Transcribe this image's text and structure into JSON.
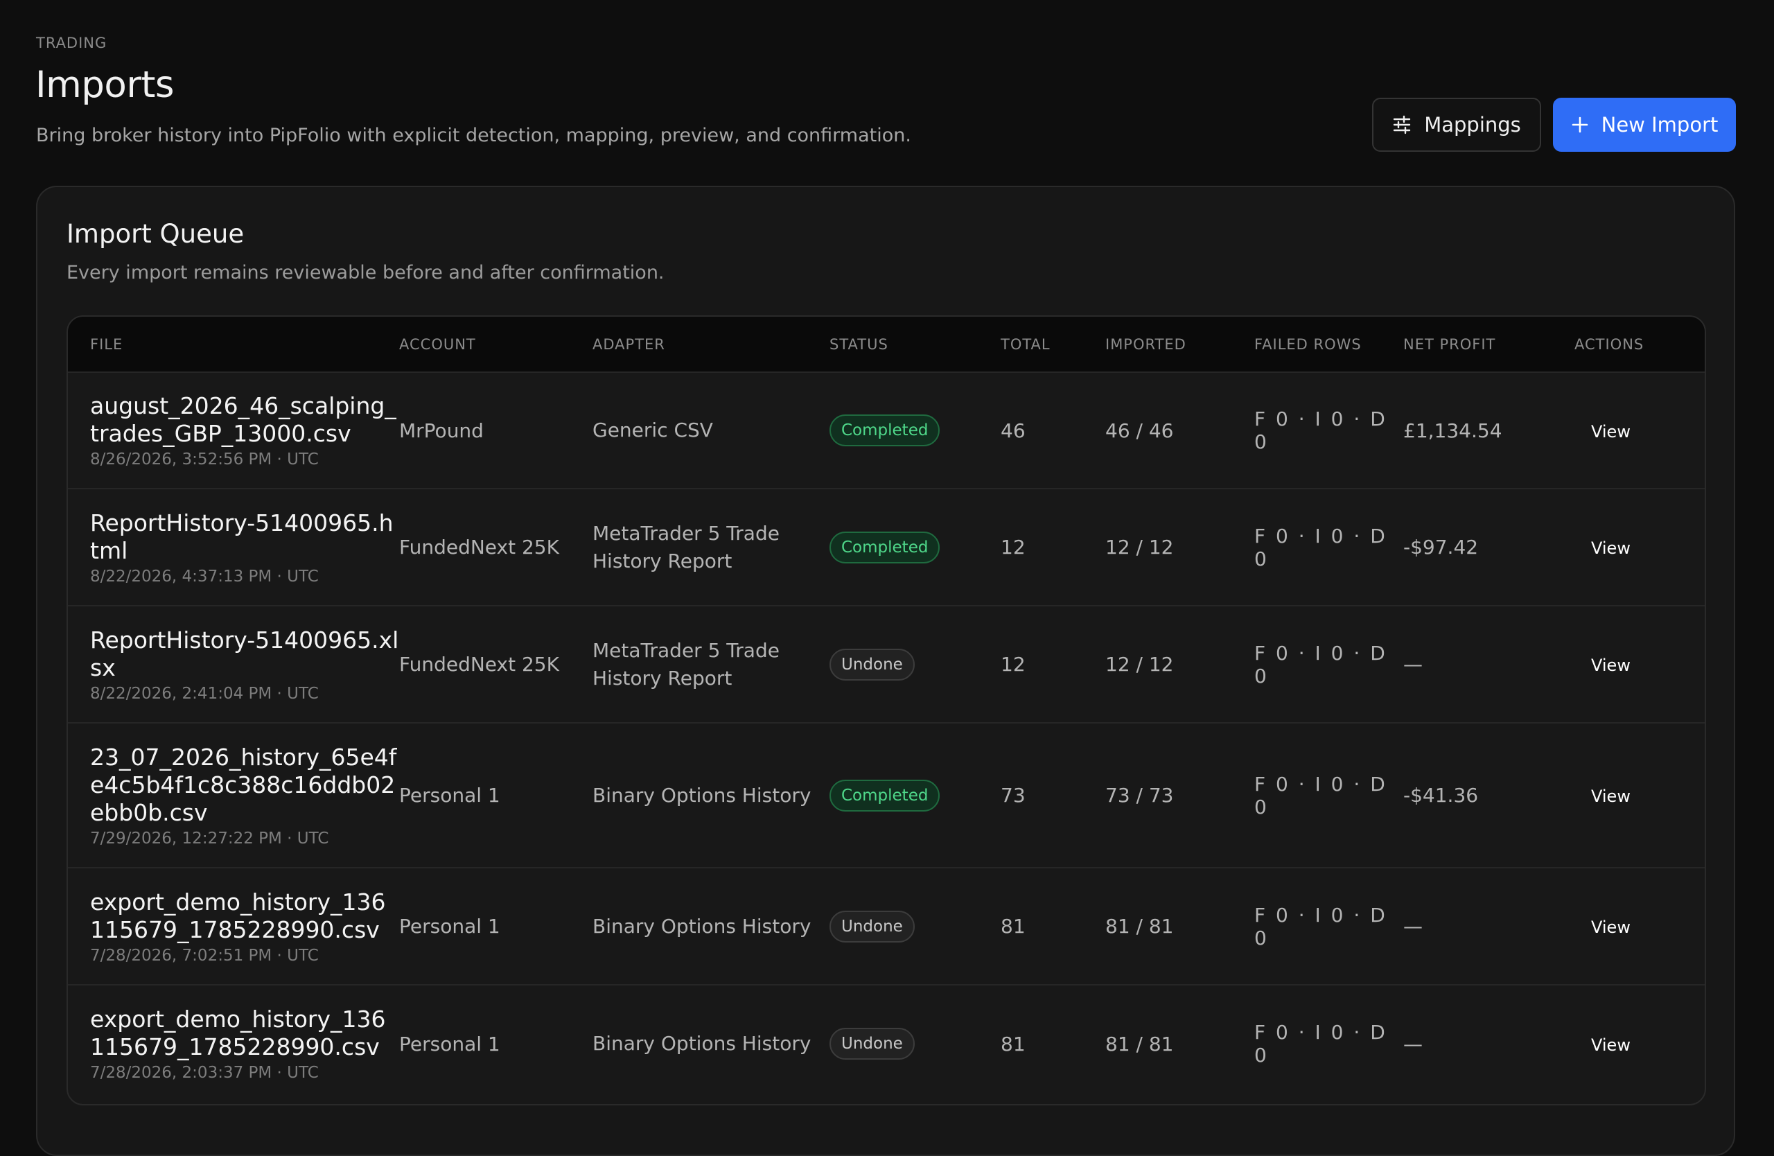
{
  "header": {
    "eyebrow": "TRADING",
    "title": "Imports",
    "subtitle": "Bring broker history into PipFolio with explicit detection, mapping, preview, and confirmation.",
    "mappings_label": "Mappings",
    "new_import_label": "New Import"
  },
  "queue": {
    "title": "Import Queue",
    "subtitle": "Every import remains reviewable before and after confirmation.",
    "columns": [
      "FILE",
      "ACCOUNT",
      "ADAPTER",
      "STATUS",
      "TOTAL",
      "IMPORTED",
      "FAILED ROWS",
      "NET PROFIT",
      "ACTIONS"
    ],
    "rows": [
      {
        "file": "august_2026_46_scalping_trades_GBP_13000.csv",
        "date": "8/26/2026, 3:52:56 PM · UTC",
        "account": "MrPound",
        "adapter": "Generic CSV",
        "status": "Completed",
        "total": "46",
        "imported": "46 / 46",
        "failed": "F 0 · I 0 · D 0",
        "net_profit": "£1,134.54",
        "action": "View"
      },
      {
        "file": "ReportHistory-51400965.html",
        "date": "8/22/2026, 4:37:13 PM · UTC",
        "account": "FundedNext 25K",
        "adapter": "MetaTrader 5 Trade History Report",
        "status": "Completed",
        "total": "12",
        "imported": "12 / 12",
        "failed": "F 0 · I 0 · D 0",
        "net_profit": "-$97.42",
        "action": "View"
      },
      {
        "file": "ReportHistory-51400965.xlsx",
        "date": "8/22/2026, 2:41:04 PM · UTC",
        "account": "FundedNext 25K",
        "adapter": "MetaTrader 5 Trade History Report",
        "status": "Undone",
        "total": "12",
        "imported": "12 / 12",
        "failed": "F 0 · I 0 · D 0",
        "net_profit": "—",
        "action": "View"
      },
      {
        "file": "23_07_2026_history_65e4fe4c5b4f1c8c388c16ddb02ebb0b.csv",
        "date": "7/29/2026, 12:27:22 PM · UTC",
        "account": "Personal 1",
        "adapter": "Binary Options History",
        "status": "Completed",
        "total": "73",
        "imported": "73 / 73",
        "failed": "F 0 · I 0 · D 0",
        "net_profit": "-$41.36",
        "action": "View"
      },
      {
        "file": "export_demo_history_136115679_1785228990.csv",
        "date": "7/28/2026, 7:02:51 PM · UTC",
        "account": "Personal 1",
        "adapter": "Binary Options History",
        "status": "Undone",
        "total": "81",
        "imported": "81 / 81",
        "failed": "F 0 · I 0 · D 0",
        "net_profit": "—",
        "action": "View"
      },
      {
        "file": "export_demo_history_136115679_1785228990.csv",
        "date": "7/28/2026, 2:03:37 PM · UTC",
        "account": "Personal 1",
        "adapter": "Binary Options History",
        "status": "Undone",
        "total": "81",
        "imported": "81 / 81",
        "failed": "F 0 · I 0 · D 0",
        "net_profit": "—",
        "action": "View"
      }
    ]
  },
  "colors": {
    "background": "#0e0e0e",
    "card": "#171717",
    "accent": "#2f6df6",
    "completed": "#4fd88a",
    "undone": "#c8c8c8"
  }
}
